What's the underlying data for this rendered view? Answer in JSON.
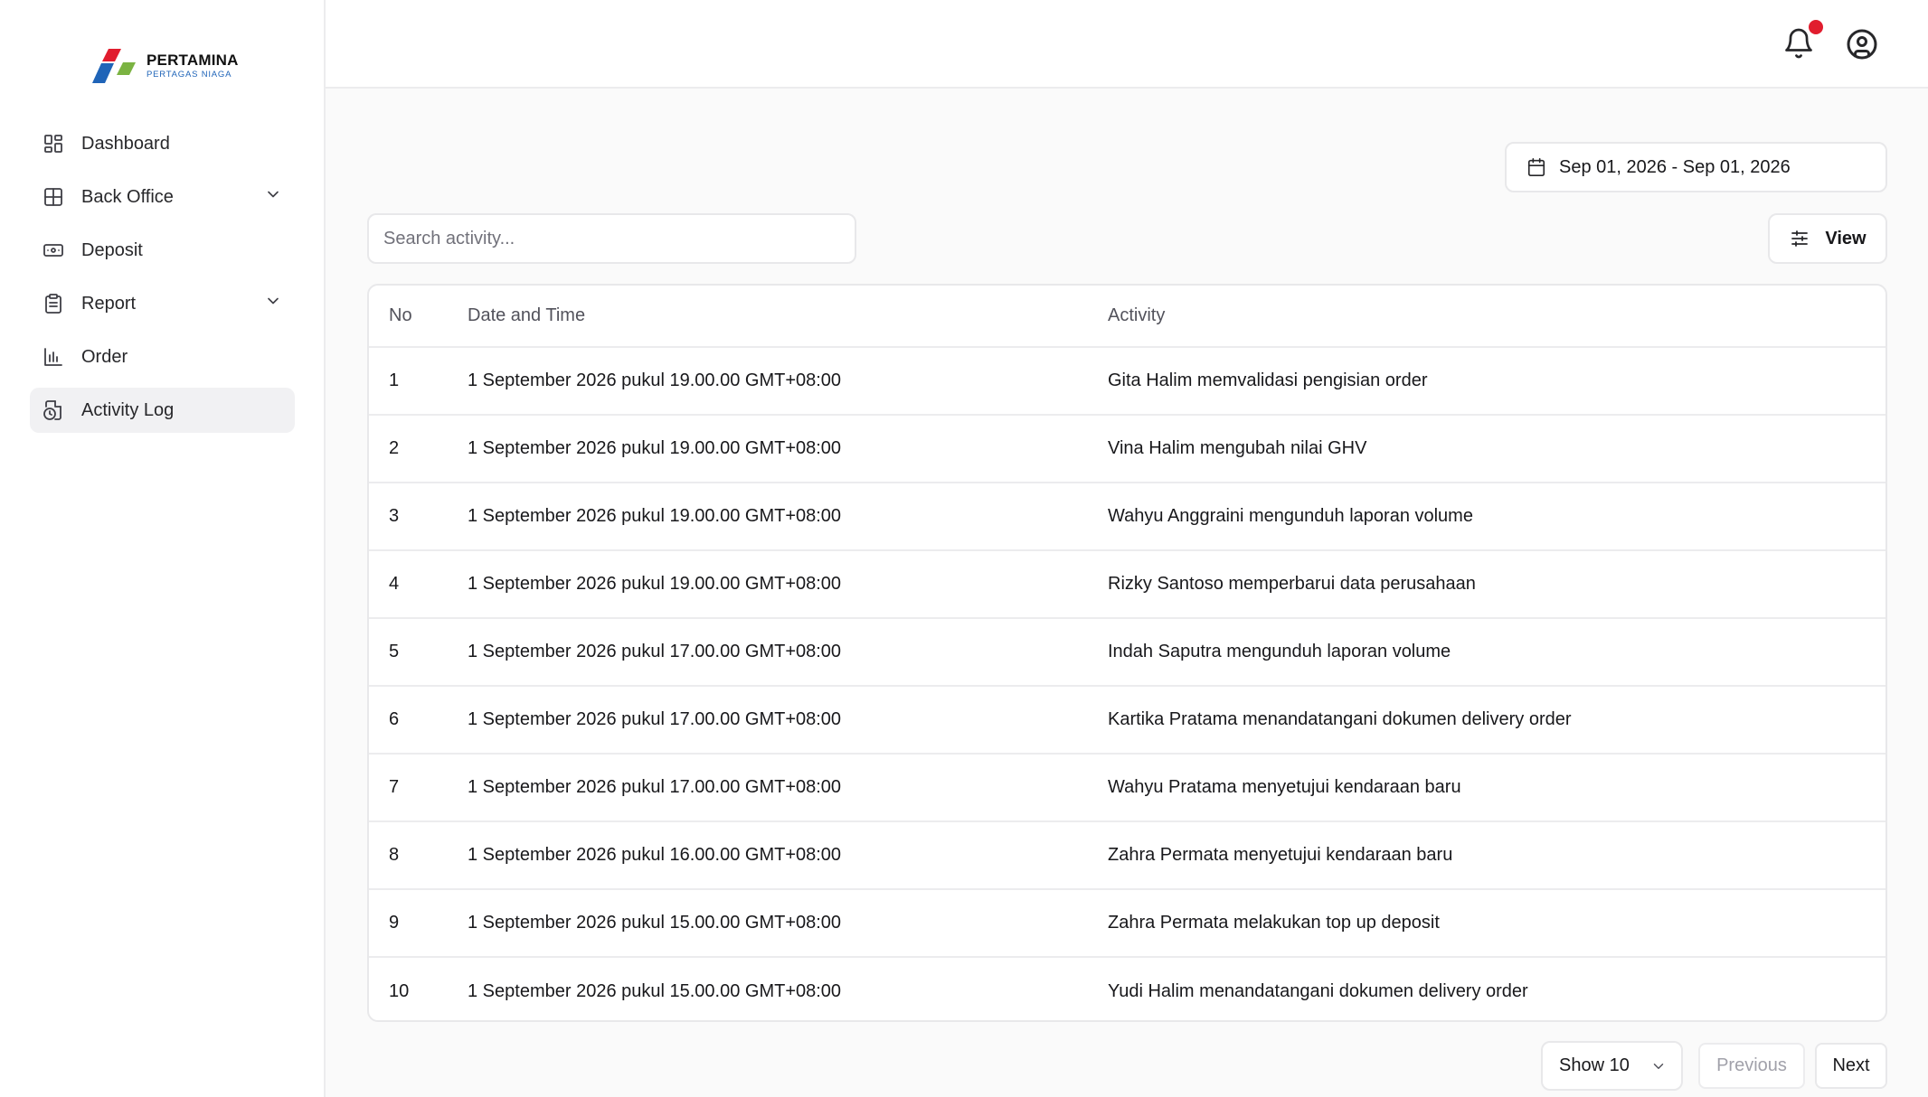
{
  "brand": {
    "name": "PERTAMINA",
    "subtitle": "PERTAGAS NIAGA"
  },
  "sidebar": {
    "items": [
      {
        "label": "Dashboard",
        "icon": "dashboard-icon"
      },
      {
        "label": "Back Office",
        "icon": "grid-icon",
        "expandable": true
      },
      {
        "label": "Deposit",
        "icon": "banknote-icon"
      },
      {
        "label": "Report",
        "icon": "clipboard-icon",
        "expandable": true
      },
      {
        "label": "Order",
        "icon": "bar-chart-icon"
      },
      {
        "label": "Activity Log",
        "icon": "file-clock-icon",
        "active": true
      }
    ]
  },
  "header": {
    "notification_icon": "bell-icon",
    "notification_dot_color": "#e11d2e",
    "account_icon": "user-circle-icon"
  },
  "filters": {
    "date_range": "Sep 01, 2026 - Sep 01, 2026",
    "search_placeholder": "Search activity...",
    "view_label": "View"
  },
  "table": {
    "columns": [
      "No",
      "Date and Time",
      "Activity"
    ],
    "rows": [
      {
        "no": "1",
        "datetime": "1 September 2026 pukul 19.00.00 GMT+08:00",
        "activity": "Gita Halim memvalidasi pengisian order"
      },
      {
        "no": "2",
        "datetime": "1 September 2026 pukul 19.00.00 GMT+08:00",
        "activity": "Vina Halim mengubah nilai GHV"
      },
      {
        "no": "3",
        "datetime": "1 September 2026 pukul 19.00.00 GMT+08:00",
        "activity": "Wahyu Anggraini mengunduh laporan volume"
      },
      {
        "no": "4",
        "datetime": "1 September 2026 pukul 19.00.00 GMT+08:00",
        "activity": "Rizky Santoso memperbarui data perusahaan"
      },
      {
        "no": "5",
        "datetime": "1 September 2026 pukul 17.00.00 GMT+08:00",
        "activity": "Indah Saputra mengunduh laporan volume"
      },
      {
        "no": "6",
        "datetime": "1 September 2026 pukul 17.00.00 GMT+08:00",
        "activity": "Kartika Pratama menandatangani dokumen delivery order"
      },
      {
        "no": "7",
        "datetime": "1 September 2026 pukul 17.00.00 GMT+08:00",
        "activity": "Wahyu Pratama menyetujui kendaraan baru"
      },
      {
        "no": "8",
        "datetime": "1 September 2026 pukul 16.00.00 GMT+08:00",
        "activity": "Zahra Permata menyetujui kendaraan baru"
      },
      {
        "no": "9",
        "datetime": "1 September 2026 pukul 15.00.00 GMT+08:00",
        "activity": "Zahra Permata melakukan top up deposit"
      },
      {
        "no": "10",
        "datetime": "1 September 2026 pukul 15.00.00 GMT+08:00",
        "activity": "Yudi Halim menandatangani dokumen delivery order"
      }
    ]
  },
  "pagination": {
    "page_size_label": "Show 10",
    "previous_label": "Previous",
    "next_label": "Next"
  }
}
